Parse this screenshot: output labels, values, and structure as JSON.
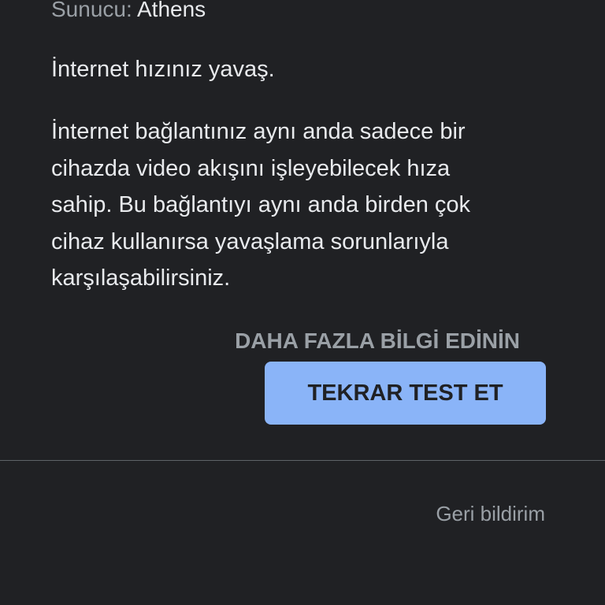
{
  "server": {
    "label": "Sunucu:",
    "value": "Athens"
  },
  "result": {
    "headline": "İnternet hızınız yavaş.",
    "description_lines": [
      "İnternet bağlantınız aynı anda sadece bir",
      "cihazda video akışını işleyebilecek hıza",
      "sahip. Bu bağlantıyı aynı anda birden çok",
      "cihaz kullanırsa yavaşlama sorunlarıyla",
      "karşılaşabilirsiniz."
    ]
  },
  "actions": {
    "learn_more": "DAHA FAZLA BİLGİ EDİNİN",
    "retest": "TEKRAR TEST ET"
  },
  "footer": {
    "feedback": "Geri bildirim"
  },
  "colors": {
    "background": "#202124",
    "primary_button": "#8ab4f8",
    "text_primary": "#e8eaed",
    "text_secondary": "#9aa0a6"
  }
}
